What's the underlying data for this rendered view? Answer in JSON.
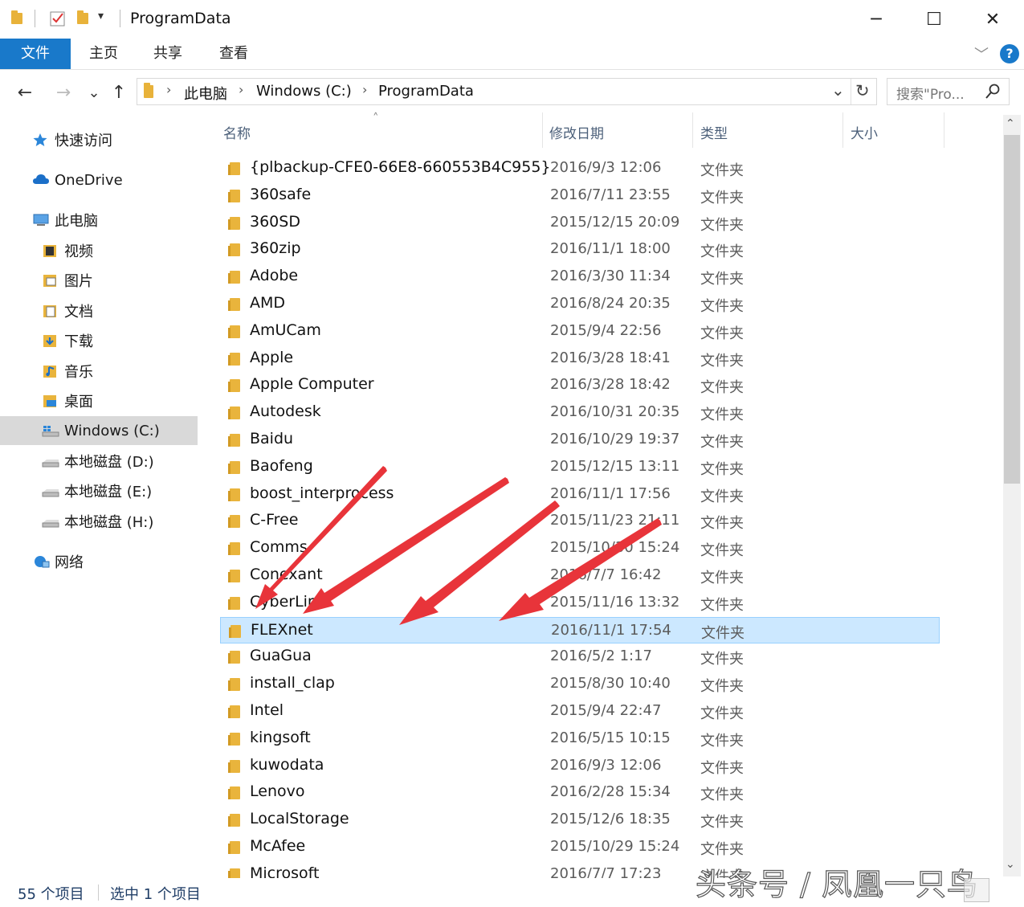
{
  "window": {
    "title": "ProgramData",
    "minimize_glyph": "─",
    "maximize_glyph": "☐",
    "close_glyph": "✕",
    "quick_access_dropdown": "▾"
  },
  "ribbon": {
    "tabs": [
      {
        "label": "文件"
      },
      {
        "label": "主页"
      },
      {
        "label": "共享"
      },
      {
        "label": "查看"
      }
    ],
    "collapse_glyph": "﹀",
    "help_glyph": "?"
  },
  "nav": {
    "back": "←",
    "forward": "→",
    "recent": "⌄",
    "up": "↑"
  },
  "address": {
    "breadcrumbs": [
      "此电脑",
      "Windows (C:)",
      "ProgramData"
    ],
    "separator": "›",
    "dropdown_glyph": "⌄",
    "refresh_glyph": "↻"
  },
  "search": {
    "placeholder": "搜索\"Pro...",
    "icon": "search-icon"
  },
  "sidebar": {
    "items": [
      {
        "label": "快速访问",
        "icon": "star-icon"
      },
      {
        "label": "OneDrive",
        "icon": "cloud-icon"
      },
      {
        "label": "此电脑",
        "icon": "computer-icon"
      },
      {
        "label": "视频",
        "icon": "video-folder-icon"
      },
      {
        "label": "图片",
        "icon": "pictures-folder-icon"
      },
      {
        "label": "文档",
        "icon": "documents-folder-icon"
      },
      {
        "label": "下载",
        "icon": "downloads-folder-icon"
      },
      {
        "label": "音乐",
        "icon": "music-folder-icon"
      },
      {
        "label": "桌面",
        "icon": "desktop-folder-icon"
      },
      {
        "label": "Windows (C:)",
        "icon": "windows-drive-icon"
      },
      {
        "label": "本地磁盘 (D:)",
        "icon": "drive-icon"
      },
      {
        "label": "本地磁盘 (E:)",
        "icon": "drive-icon"
      },
      {
        "label": "本地磁盘 (H:)",
        "icon": "drive-icon"
      },
      {
        "label": "网络",
        "icon": "network-icon"
      }
    ]
  },
  "columns": {
    "name": "名称",
    "date": "修改日期",
    "type": "类型",
    "size": "大小",
    "sort_glyph": "˄"
  },
  "files": [
    {
      "name": "{plbackup-CFE0-66E8-660553B4C955}",
      "date": "2016/9/3 12:06",
      "type": "文件夹"
    },
    {
      "name": "360safe",
      "date": "2016/7/11 23:55",
      "type": "文件夹"
    },
    {
      "name": "360SD",
      "date": "2015/12/15 20:09",
      "type": "文件夹"
    },
    {
      "name": "360zip",
      "date": "2016/11/1 18:00",
      "type": "文件夹"
    },
    {
      "name": "Adobe",
      "date": "2016/3/30 11:34",
      "type": "文件夹"
    },
    {
      "name": "AMD",
      "date": "2016/8/24 20:35",
      "type": "文件夹"
    },
    {
      "name": "AmUCam",
      "date": "2015/9/4 22:56",
      "type": "文件夹"
    },
    {
      "name": "Apple",
      "date": "2016/3/28 18:41",
      "type": "文件夹"
    },
    {
      "name": "Apple Computer",
      "date": "2016/3/28 18:42",
      "type": "文件夹"
    },
    {
      "name": "Autodesk",
      "date": "2016/10/31 20:35",
      "type": "文件夹"
    },
    {
      "name": "Baidu",
      "date": "2016/10/29 19:37",
      "type": "文件夹"
    },
    {
      "name": "Baofeng",
      "date": "2015/12/15 13:11",
      "type": "文件夹"
    },
    {
      "name": "boost_interprocess",
      "date": "2016/11/1 17:56",
      "type": "文件夹"
    },
    {
      "name": "C-Free",
      "date": "2015/11/23 21:11",
      "type": "文件夹"
    },
    {
      "name": "Comms",
      "date": "2015/10/30 15:24",
      "type": "文件夹"
    },
    {
      "name": "Conexant",
      "date": "2016/7/7 16:42",
      "type": "文件夹"
    },
    {
      "name": "CyberLink",
      "date": "2015/11/16 13:32",
      "type": "文件夹"
    },
    {
      "name": "FLEXnet",
      "date": "2016/11/1 17:54",
      "type": "文件夹",
      "selected": true
    },
    {
      "name": "GuaGua",
      "date": "2016/5/2 1:17",
      "type": "文件夹"
    },
    {
      "name": "install_clap",
      "date": "2015/8/30 10:40",
      "type": "文件夹"
    },
    {
      "name": "Intel",
      "date": "2015/9/4 22:47",
      "type": "文件夹"
    },
    {
      "name": "kingsoft",
      "date": "2016/5/15 10:15",
      "type": "文件夹"
    },
    {
      "name": "kuwodata",
      "date": "2016/9/3 12:06",
      "type": "文件夹"
    },
    {
      "name": "Lenovo",
      "date": "2016/2/28 15:34",
      "type": "文件夹"
    },
    {
      "name": "LocalStorage",
      "date": "2015/12/6 18:35",
      "type": "文件夹"
    },
    {
      "name": "McAfee",
      "date": "2015/10/29 15:24",
      "type": "文件夹"
    },
    {
      "name": "Microsoft",
      "date": "2016/7/7 17:23",
      "type": "文件夹"
    }
  ],
  "status": {
    "item_count": "55 个项目",
    "selected_count": "选中 1 个项目"
  },
  "watermark": "头条号 / 凤凰一只鸟",
  "colors": {
    "accent": "#1979ca",
    "selection_fill": "#cce8ff",
    "selection_border": "#99d1ff",
    "folder": "#e9b43c",
    "annotation_arrow": "#e8343a"
  }
}
